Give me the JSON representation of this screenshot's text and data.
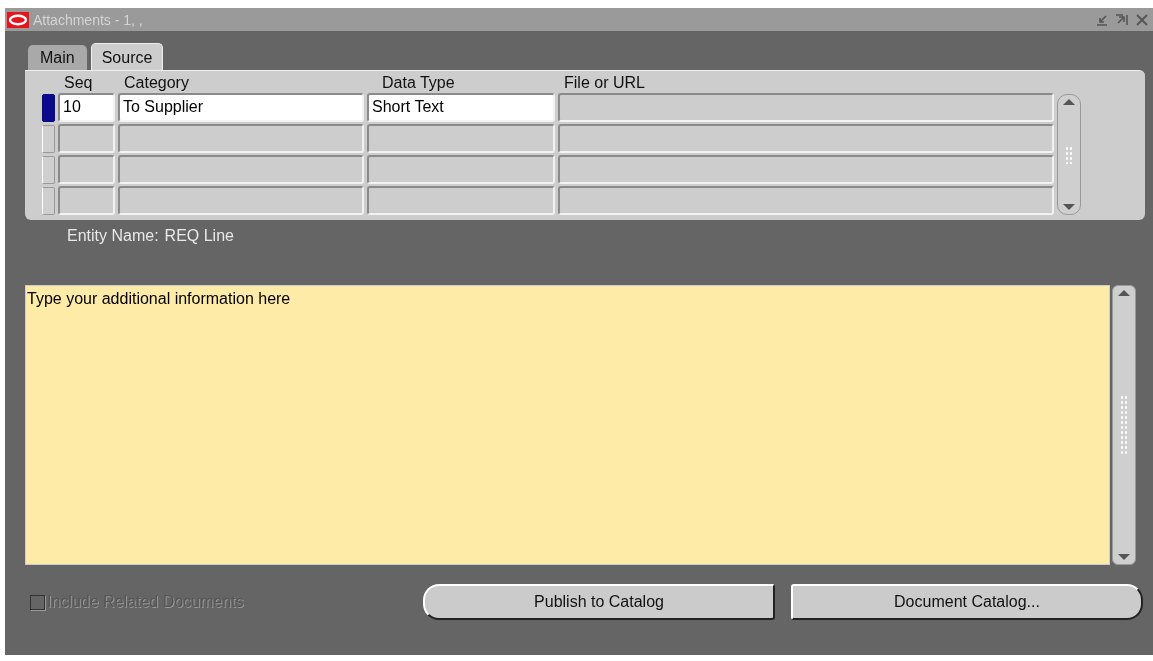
{
  "window": {
    "title": "Attachments - 1, ,"
  },
  "tabs": [
    {
      "label": "Main",
      "selected": false
    },
    {
      "label": "Source",
      "selected": true
    }
  ],
  "table": {
    "columns": [
      "Seq",
      "Category",
      "Data Type",
      "File or URL"
    ],
    "rows": [
      {
        "selected": true,
        "seq": "10",
        "category": "To Supplier",
        "data_type": "Short Text"
      },
      {
        "selected": false
      },
      {
        "selected": false
      },
      {
        "selected": false
      }
    ]
  },
  "entity_name": {
    "label": "Entity Name:",
    "value": "REQ Line"
  },
  "text_area": {
    "value": "Type your additional information here"
  },
  "include_related": {
    "label": "Include Related Documents",
    "checked": false,
    "disabled": true
  },
  "buttons": [
    "Publish to Catalog",
    "Document Catalog..."
  ]
}
